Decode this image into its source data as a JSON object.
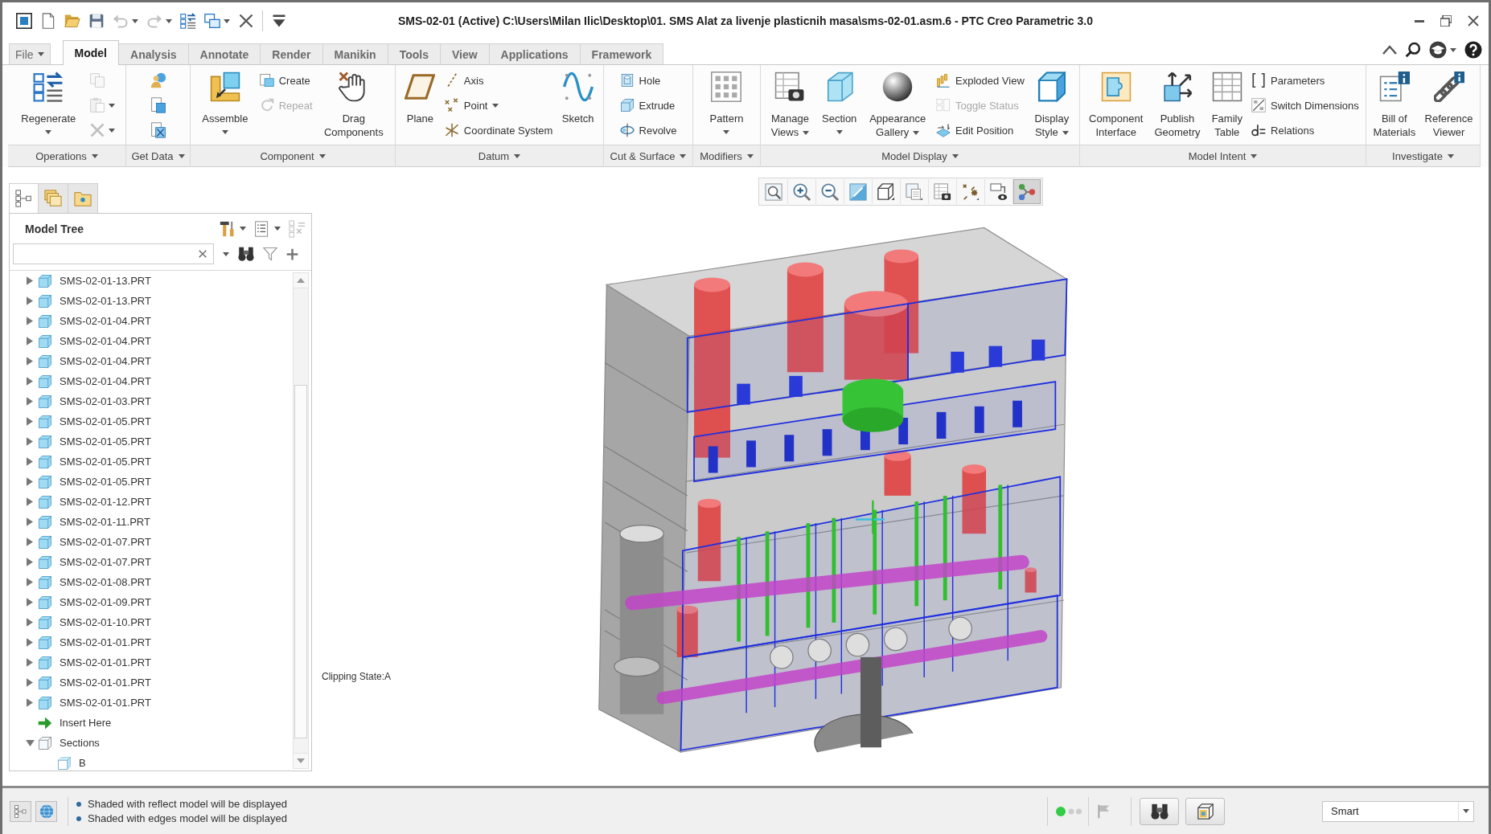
{
  "window": {
    "title": "SMS-02-01 (Active) C:\\Users\\Milan Ilic\\Desktop\\01. SMS Alat za livenje plasticnih masa\\sms-02-01.asm.6 - PTC Creo Parametric 3.0"
  },
  "quick_access": [
    {
      "menu": false,
      "disabled": false
    },
    {
      "menu": false,
      "disabled": false
    },
    {
      "menu": false,
      "disabled": false
    },
    {
      "menu": true,
      "disabled": true
    },
    {
      "menu": true,
      "disabled": true
    },
    {
      "menu": false,
      "disabled": false
    },
    {
      "menu": true,
      "disabled": false
    },
    {
      "menu": false,
      "disabled": false
    },
    {
      "menu": false,
      "disabled": false
    }
  ],
  "tabs": [
    {
      "label": "File",
      "selected": false,
      "menu": true
    },
    {
      "label": "Model",
      "selected": true,
      "menu": false
    },
    {
      "label": "Analysis",
      "selected": false,
      "menu": false
    },
    {
      "label": "Annotate",
      "selected": false,
      "menu": false
    },
    {
      "label": "Render",
      "selected": false,
      "menu": false
    },
    {
      "label": "Manikin",
      "selected": false,
      "menu": false
    },
    {
      "label": "Tools",
      "selected": false,
      "menu": false
    },
    {
      "label": "View",
      "selected": false,
      "menu": false
    },
    {
      "label": "Applications",
      "selected": false,
      "menu": false
    },
    {
      "label": "Framework",
      "selected": false,
      "menu": false
    }
  ],
  "ribbon": {
    "groups": [
      {
        "label": "Operations",
        "menu": true,
        "commands": [
          {
            "kind": "large",
            "label": "Regenerate",
            "menu": true,
            "disabled": false
          },
          {
            "kind": "icon",
            "menu": false,
            "disabled": true
          },
          {
            "kind": "icon",
            "menu": true,
            "disabled": true
          },
          {
            "kind": "icon",
            "menu": true,
            "disabled": true
          }
        ]
      },
      {
        "label": "Get Data",
        "menu": true,
        "commands": [
          {
            "kind": "icon",
            "menu": false,
            "disabled": false
          },
          {
            "kind": "icon",
            "menu": false,
            "disabled": false
          },
          {
            "kind": "icon",
            "menu": false,
            "disabled": false
          }
        ]
      },
      {
        "label": "Component",
        "menu": true,
        "commands": [
          {
            "kind": "large",
            "label": "Assemble",
            "menu": true,
            "disabled": false
          },
          {
            "kind": "small",
            "label": "Create",
            "menu": false,
            "disabled": false
          },
          {
            "kind": "small",
            "label": "Repeat",
            "menu": false,
            "disabled": true
          },
          {
            "kind": "large",
            "label": "Drag\nComponents",
            "menu": false,
            "disabled": false
          }
        ]
      },
      {
        "label": "Datum",
        "menu": true,
        "commands": [
          {
            "kind": "large",
            "label": "Plane",
            "menu": false,
            "disabled": false
          },
          {
            "kind": "small",
            "label": "Axis",
            "menu": false,
            "disabled": false
          },
          {
            "kind": "small",
            "label": "Point",
            "menu": true,
            "disabled": false
          },
          {
            "kind": "small",
            "label": "Coordinate System",
            "menu": false,
            "disabled": false
          },
          {
            "kind": "large",
            "label": "Sketch",
            "menu": false,
            "disabled": false
          }
        ]
      },
      {
        "label": "Cut & Surface",
        "menu": true,
        "commands": [
          {
            "kind": "small",
            "label": "Hole",
            "menu": false,
            "disabled": false
          },
          {
            "kind": "small",
            "label": "Extrude",
            "menu": false,
            "disabled": false
          },
          {
            "kind": "small",
            "label": "Revolve",
            "menu": false,
            "disabled": false
          }
        ]
      },
      {
        "label": "Modifiers",
        "menu": true,
        "commands": [
          {
            "kind": "large",
            "label": "Pattern",
            "menu": true,
            "disabled": false
          }
        ]
      },
      {
        "label": "Model Display",
        "menu": true,
        "commands": [
          {
            "kind": "large",
            "label": "Manage\nViews",
            "menu": true,
            "disabled": false
          },
          {
            "kind": "large",
            "label": "Section",
            "menu": true,
            "disabled": false
          },
          {
            "kind": "large",
            "label": "Appearance\nGallery",
            "menu": true,
            "disabled": false
          },
          {
            "kind": "small",
            "label": "Exploded View",
            "menu": false,
            "disabled": false
          },
          {
            "kind": "small",
            "label": "Toggle Status",
            "menu": false,
            "disabled": true
          },
          {
            "kind": "small",
            "label": "Edit Position",
            "menu": false,
            "disabled": false
          },
          {
            "kind": "large",
            "label": "Display\nStyle",
            "menu": true,
            "disabled": false
          }
        ]
      },
      {
        "label": "Model Intent",
        "menu": true,
        "commands": [
          {
            "kind": "large",
            "label": "Component\nInterface",
            "menu": false,
            "disabled": false
          },
          {
            "kind": "large",
            "label": "Publish\nGeometry",
            "menu": false,
            "disabled": false
          },
          {
            "kind": "large",
            "label": "Family\nTable",
            "menu": false,
            "disabled": false
          },
          {
            "kind": "small",
            "label": "Parameters",
            "menu": false,
            "disabled": false
          },
          {
            "kind": "small",
            "label": "Switch Dimensions",
            "menu": false,
            "disabled": false
          },
          {
            "kind": "small",
            "label": "Relations",
            "menu": false,
            "disabled": false
          }
        ]
      },
      {
        "label": "Investigate",
        "menu": true,
        "commands": [
          {
            "kind": "large",
            "label": "Bill of\nMaterials",
            "menu": false,
            "disabled": false
          },
          {
            "kind": "large",
            "label": "Reference\nViewer",
            "menu": false,
            "disabled": false
          }
        ]
      }
    ]
  },
  "navigator": {
    "tabs": [
      {
        "selected": true
      },
      {
        "selected": false
      },
      {
        "selected": false
      }
    ]
  },
  "model_tree": {
    "title": "Model Tree",
    "items": [
      {
        "label": "SMS-02-01-13.PRT",
        "kind": "part",
        "expanded": false
      },
      {
        "label": "SMS-02-01-13.PRT",
        "kind": "part",
        "expanded": false
      },
      {
        "label": "SMS-02-01-04.PRT",
        "kind": "part",
        "expanded": false
      },
      {
        "label": "SMS-02-01-04.PRT",
        "kind": "part",
        "expanded": false
      },
      {
        "label": "SMS-02-01-04.PRT",
        "kind": "part",
        "expanded": false
      },
      {
        "label": "SMS-02-01-04.PRT",
        "kind": "part",
        "expanded": false
      },
      {
        "label": "SMS-02-01-03.PRT",
        "kind": "part",
        "expanded": false
      },
      {
        "label": "SMS-02-01-05.PRT",
        "kind": "part",
        "expanded": false
      },
      {
        "label": "SMS-02-01-05.PRT",
        "kind": "part",
        "expanded": false
      },
      {
        "label": "SMS-02-01-05.PRT",
        "kind": "part",
        "expanded": false
      },
      {
        "label": "SMS-02-01-05.PRT",
        "kind": "part",
        "expanded": false
      },
      {
        "label": "SMS-02-01-12.PRT",
        "kind": "part",
        "expanded": false
      },
      {
        "label": "SMS-02-01-11.PRT",
        "kind": "part",
        "expanded": false
      },
      {
        "label": "SMS-02-01-07.PRT",
        "kind": "part",
        "expanded": false
      },
      {
        "label": "SMS-02-01-07.PRT",
        "kind": "part",
        "expanded": false
      },
      {
        "label": "SMS-02-01-08.PRT",
        "kind": "part",
        "expanded": false
      },
      {
        "label": "SMS-02-01-09.PRT",
        "kind": "part",
        "expanded": false
      },
      {
        "label": "SMS-02-01-10.PRT",
        "kind": "part",
        "expanded": false
      },
      {
        "label": "SMS-02-01-01.PRT",
        "kind": "part",
        "expanded": false
      },
      {
        "label": "SMS-02-01-01.PRT",
        "kind": "part",
        "expanded": false
      },
      {
        "label": "SMS-02-01-01.PRT",
        "kind": "part",
        "expanded": false
      },
      {
        "label": "SMS-02-01-01.PRT",
        "kind": "part",
        "expanded": false
      },
      {
        "label": "Insert Here",
        "kind": "insert"
      },
      {
        "label": "Sections",
        "kind": "sections",
        "expanded": true,
        "children": [
          {
            "label": "B",
            "kind": "section"
          }
        ]
      }
    ]
  },
  "graphics": {
    "toolbar": [
      {
        "selected": false
      },
      {
        "selected": false
      },
      {
        "selected": false
      },
      {
        "selected": false
      },
      {
        "selected": false
      },
      {
        "selected": false
      },
      {
        "selected": false
      },
      {
        "selected": false
      },
      {
        "selected": false
      },
      {
        "selected": true
      }
    ],
    "clipping_state": "Clipping State:A"
  },
  "status_bar": {
    "messages": [
      "Shaded with reflect model will be displayed",
      "Shaded with edges model will be displayed"
    ],
    "selection_filter": "Smart"
  }
}
